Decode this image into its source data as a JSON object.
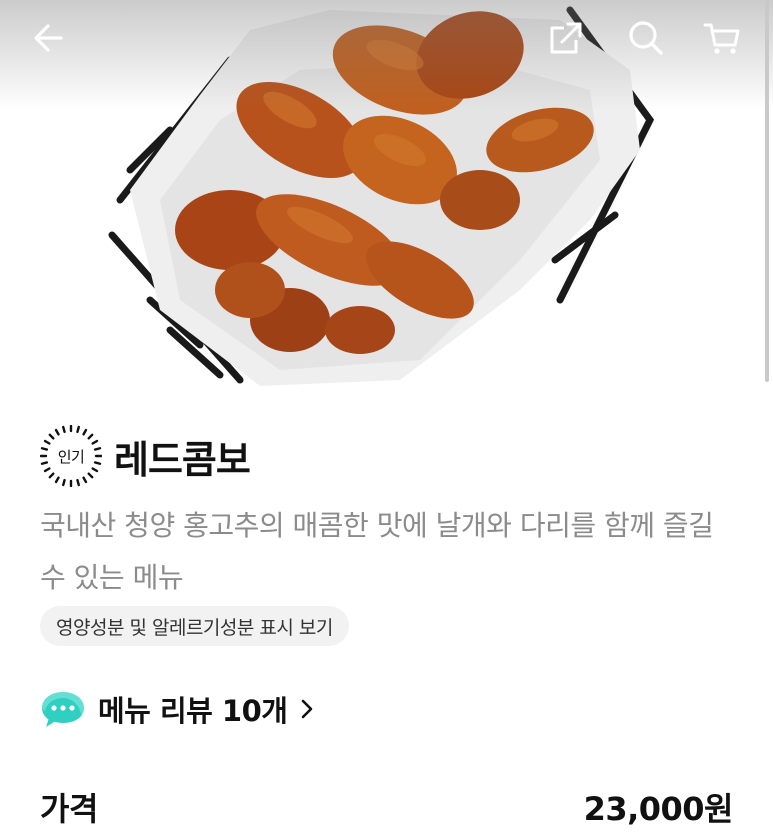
{
  "topbar": {
    "back_icon": "arrow-left-icon",
    "share_icon": "share-icon",
    "search_icon": "search-icon",
    "cart_icon": "cart-icon"
  },
  "hero": {
    "image": "fried-chicken-basket-photo"
  },
  "menu": {
    "badge": "인기",
    "title": "레드콤보",
    "description": "국내산 청양 홍고추의 매콤한 맛에 날개와 다리를 함께 즐길 수 있는 메뉴",
    "allergy_button": "영양성분 및 알레르기성분 표시 보기"
  },
  "review": {
    "icon": "chat-bubble-icon",
    "label": "메뉴 리뷰 10개"
  },
  "price": {
    "label": "가격",
    "value": "23,000원"
  },
  "colors": {
    "review_icon": "#2fd0c2",
    "description_text": "#8b8b8b",
    "chip_bg": "#f2f2f2"
  }
}
